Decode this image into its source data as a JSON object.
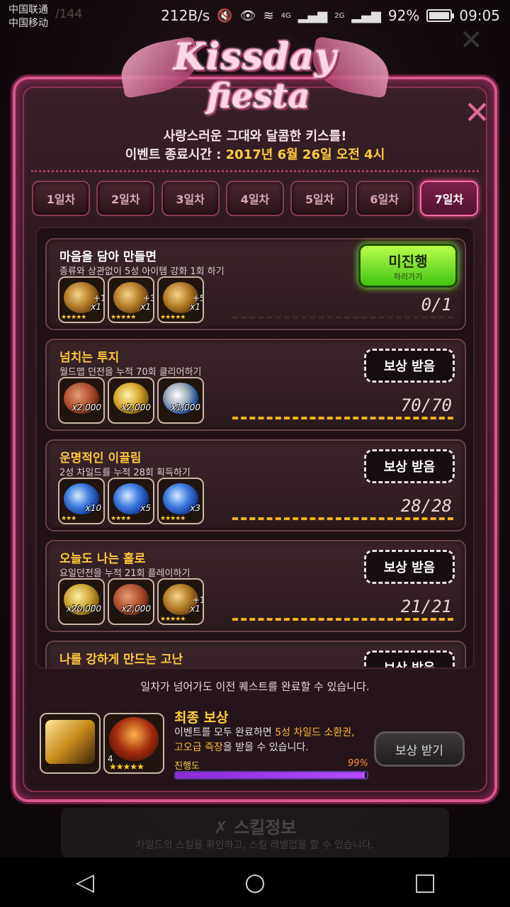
{
  "status_bar": {
    "carrier1": "中国联通",
    "carrier2": "中国移动",
    "net_speed": "212B/s",
    "network": "4G",
    "network2": "2G",
    "battery": "92%",
    "time": "09:05",
    "bg_counter": "/144"
  },
  "event": {
    "logo_line1": "Kissday",
    "logo_line2": "fiesta",
    "subtitle": "사랑스러운 그대와 달콤한 키스를!",
    "end_label": "이벤트 종료시간 : ",
    "end_value": "2017년 6월 26일 오전 4시"
  },
  "tabs": [
    {
      "label": "1일차",
      "active": false
    },
    {
      "label": "2일차",
      "active": false
    },
    {
      "label": "3일차",
      "active": false
    },
    {
      "label": "4일차",
      "active": false
    },
    {
      "label": "5일차",
      "active": false
    },
    {
      "label": "6일차",
      "active": false
    },
    {
      "label": "7일차",
      "active": true
    }
  ],
  "quests": [
    {
      "title": "마음을 담아 만들면",
      "title_color": "#ffffff",
      "desc": "종류와 상관없이 5성 아이템 강화 1회 하기",
      "items": [
        {
          "icon": "enhance-gear-icon",
          "qty": "x1",
          "level": "+1",
          "stars": "★★★★★"
        },
        {
          "icon": "enhance-gear-icon",
          "qty": "x1",
          "level": "+3",
          "stars": "★★★★★"
        },
        {
          "icon": "enhance-gear-icon",
          "qty": "x1",
          "level": "+5",
          "stars": "★★★★★"
        }
      ],
      "progress": "0/1",
      "completion": 0,
      "button": {
        "type": "go",
        "line1": "미진행",
        "line2": "하러가기"
      }
    },
    {
      "title": "넘치는 투지",
      "title_color": "#ffc83a",
      "desc": "월드맵 던전을 누적 70회 클리어하기",
      "items": [
        {
          "icon": "copper-coin-icon",
          "qty": "x2,000",
          "stars": ""
        },
        {
          "icon": "gold-coin-icon",
          "qty": "x2,000",
          "stars": ""
        },
        {
          "icon": "silver-ring-icon",
          "qty": "x1,000",
          "stars": ""
        }
      ],
      "progress": "70/70",
      "completion": 1,
      "button": {
        "type": "claim",
        "label": "보상 받음"
      }
    },
    {
      "title": "운명적인 이끌림",
      "title_color": "#ffc83a",
      "desc": "2성 차일드를 누적 28회 획득하기",
      "items": [
        {
          "icon": "blue-gem-icon",
          "qty": "x10",
          "stars": "★★★"
        },
        {
          "icon": "blue-gem-icon",
          "qty": "x5",
          "stars": "★★★★"
        },
        {
          "icon": "blue-gem-icon",
          "qty": "x3",
          "stars": "★★★★★"
        }
      ],
      "progress": "28/28",
      "completion": 1,
      "button": {
        "type": "claim",
        "label": "보상 받음"
      }
    },
    {
      "title": "오늘도 나는 홀로",
      "title_color": "#ffc83a",
      "desc": "요일던전을 누적 21회 플레이하기",
      "items": [
        {
          "icon": "gold-coins-icon",
          "qty": "x20,000",
          "stars": ""
        },
        {
          "icon": "copper-coin-icon",
          "qty": "x2,000",
          "stars": ""
        },
        {
          "icon": "enhance-gear-icon",
          "qty": "x1",
          "level": "+1",
          "stars": "★★★★★"
        }
      ],
      "progress": "21/21",
      "completion": 1,
      "button": {
        "type": "claim",
        "label": "보상 받음"
      }
    },
    {
      "title": "나를 강하게 만드는 고난",
      "title_color": "#ffc83a",
      "desc": "",
      "items": [],
      "progress": "",
      "completion": 1,
      "button": {
        "type": "claim",
        "label": "보상 받음"
      }
    }
  ],
  "footer_note": "일차가 넘어가도 이전 퀘스트를 완료할 수 있습니다.",
  "final_reward": {
    "title": "최종 보상",
    "desc_pre": "이벤트를 모두 완료하면 ",
    "desc_hl1": "5성 차일드 소환권,",
    "desc_hl2": "고오급 즉장",
    "desc_post": "을 받을 수 있습니다.",
    "progress_label": "진행도",
    "progress_pct": "99%",
    "progress_value": 0.99,
    "button": "보상 받기",
    "items": [
      {
        "icon": "summon-ticket-icon",
        "stars": ""
      },
      {
        "icon": "sword-equipment-icon",
        "level": "4",
        "stars": "★★★★★"
      }
    ]
  },
  "background": {
    "skill_title": "스킬정보",
    "skill_desc": "차일드의 스킬을 확인하고, 스킬 레벨업을 할 수 있습니다."
  }
}
